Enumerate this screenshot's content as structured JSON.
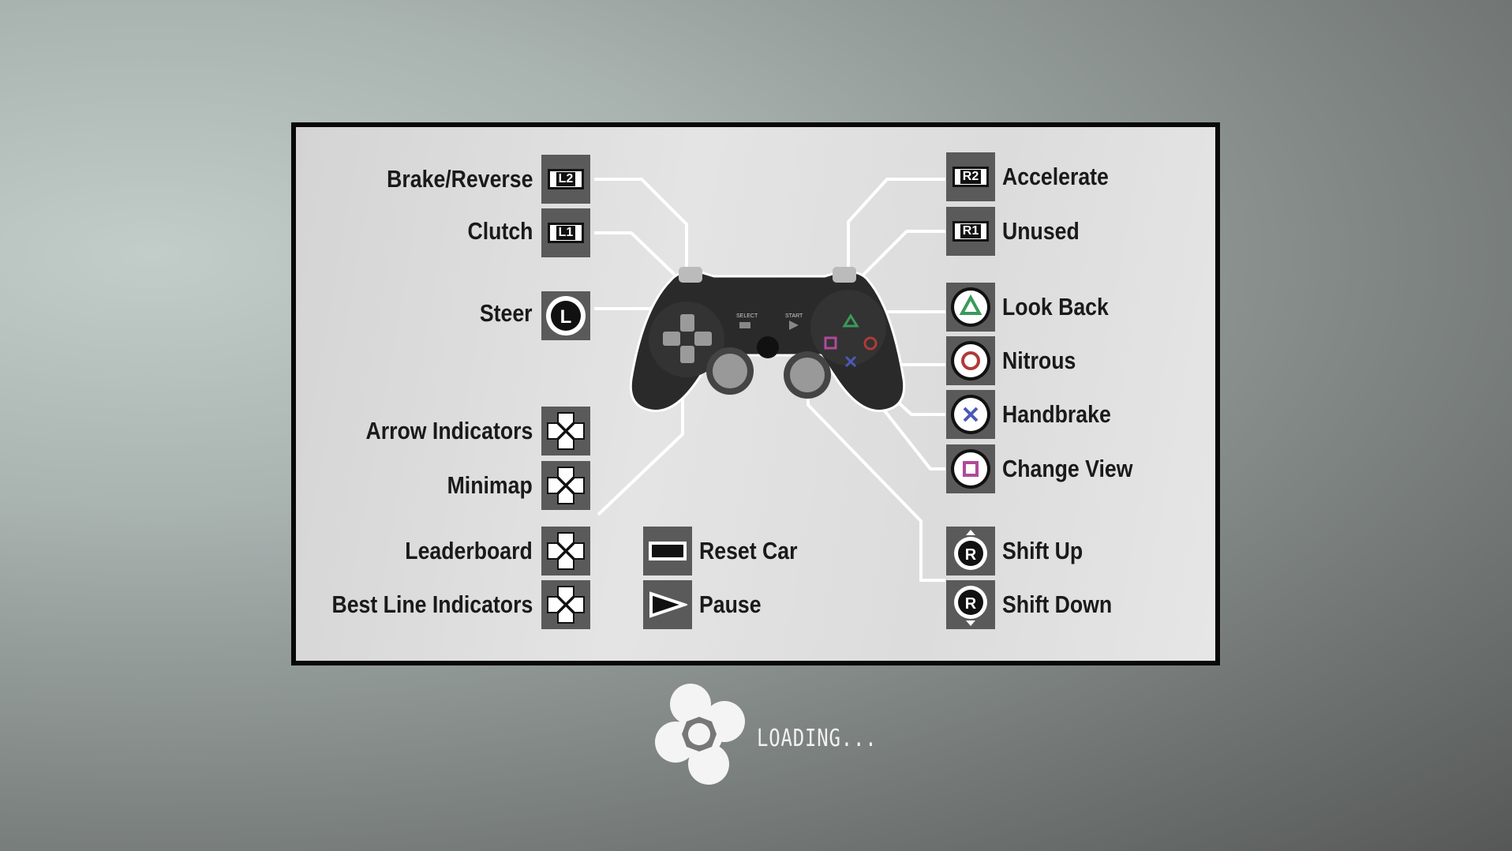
{
  "left_bindings": [
    {
      "label": "Brake/Reverse",
      "icon": "l2-trigger-icon",
      "key": "L2"
    },
    {
      "label": "Clutch",
      "icon": "l1-bumper-icon",
      "key": "L1"
    },
    {
      "label": "Steer",
      "icon": "left-stick-icon",
      "key": "L"
    },
    {
      "label": "Arrow Indicators",
      "icon": "dpad-up-icon"
    },
    {
      "label": "Minimap",
      "icon": "dpad-down-icon"
    },
    {
      "label": "Leaderboard",
      "icon": "dpad-left-icon"
    },
    {
      "label": "Best Line Indicators",
      "icon": "dpad-right-icon"
    }
  ],
  "middle_bindings": [
    {
      "label": "Reset Car",
      "icon": "select-button-icon"
    },
    {
      "label": "Pause",
      "icon": "start-button-icon"
    }
  ],
  "right_bindings": [
    {
      "label": "Accelerate",
      "icon": "r2-trigger-icon",
      "key": "R2"
    },
    {
      "label": "Unused",
      "icon": "r1-bumper-icon",
      "key": "R1"
    },
    {
      "label": "Look Back",
      "icon": "triangle-button-icon",
      "color": "#3a9a5a"
    },
    {
      "label": "Nitrous",
      "icon": "circle-button-icon",
      "color": "#b03a3a"
    },
    {
      "label": "Handbrake",
      "icon": "cross-button-icon",
      "color": "#4a5ab8"
    },
    {
      "label": "Change View",
      "icon": "square-button-icon",
      "color": "#b04a9a"
    },
    {
      "label": "Shift Up",
      "icon": "right-stick-up-icon",
      "key": "R"
    },
    {
      "label": "Shift Down",
      "icon": "right-stick-down-icon",
      "key": "R"
    }
  ],
  "loading": {
    "text": "LOADING...",
    "icon": "loading-spinner-icon"
  },
  "controller_labels": {
    "select": "SELECT",
    "start": "START"
  }
}
